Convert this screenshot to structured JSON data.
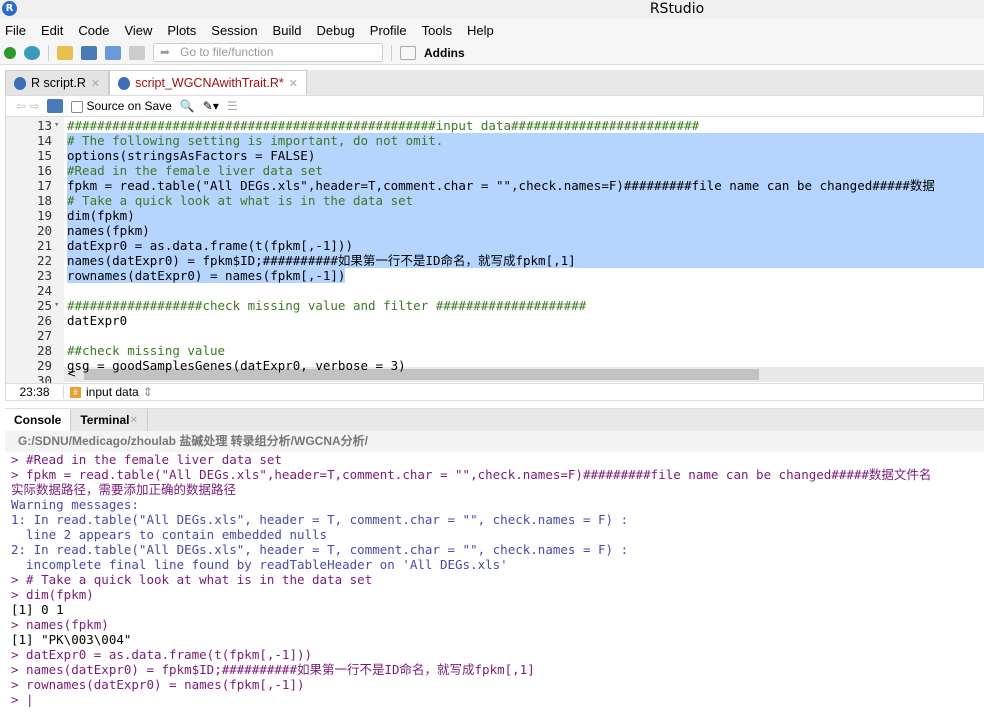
{
  "window": {
    "title": "RStudio",
    "logo": "R"
  },
  "menu": [
    "File",
    "Edit",
    "Code",
    "View",
    "Plots",
    "Session",
    "Build",
    "Debug",
    "Profile",
    "Tools",
    "Help"
  ],
  "toolbar": {
    "goto_placeholder": "Go to file/function",
    "addins": "Addins"
  },
  "tabs": [
    {
      "label": "R script.R",
      "active": false
    },
    {
      "label": "script_WGCNAwithTrait.R*",
      "active": true
    }
  ],
  "editor_toolbar": {
    "source_on_save": "Source on Save"
  },
  "editor": {
    "lines": [
      {
        "n": "13",
        "fold": true,
        "sel": false,
        "text": "#################################################input data#########################",
        "cls": "cm"
      },
      {
        "n": "14",
        "sel": true,
        "text": "# The following setting is important, do not omit.",
        "cls": "cm"
      },
      {
        "n": "15",
        "sel": true,
        "text": "options(stringsAsFactors = FALSE)",
        "cls": ""
      },
      {
        "n": "16",
        "sel": true,
        "text": "#Read in the female liver data set",
        "cls": "cm"
      },
      {
        "n": "17",
        "sel": true,
        "text": "fpkm = read.table(\"All DEGs.xls\",header=T,comment.char = \"\",check.names=F)#########file name can be changed#####数据",
        "cls": ""
      },
      {
        "n": "18",
        "sel": true,
        "text": "# Take a quick look at what is in the data set",
        "cls": "cm"
      },
      {
        "n": "19",
        "sel": true,
        "text": "dim(fpkm)",
        "cls": ""
      },
      {
        "n": "20",
        "sel": true,
        "text": "names(fpkm)",
        "cls": ""
      },
      {
        "n": "21",
        "sel": true,
        "text": "datExpr0 = as.data.frame(t(fpkm[,-1]))",
        "cls": ""
      },
      {
        "n": "22",
        "sel": true,
        "text": "names(datExpr0) = fpkm$ID;##########如果第一行不是ID命名，就写成fpkm[,1]",
        "cls": ""
      },
      {
        "n": "23",
        "sel": "partial",
        "text": "rownames(datExpr0) = names(fpkm[,-1])",
        "cls": ""
      },
      {
        "n": "24",
        "sel": false,
        "text": "",
        "cls": ""
      },
      {
        "n": "25",
        "fold": true,
        "sel": false,
        "text": "##################check missing value and filter ####################",
        "cls": "cm"
      },
      {
        "n": "26",
        "sel": false,
        "text": "datExpr0",
        "cls": ""
      },
      {
        "n": "27",
        "sel": false,
        "text": "",
        "cls": ""
      },
      {
        "n": "28",
        "sel": false,
        "text": "##check missing value",
        "cls": "cm"
      },
      {
        "n": "29",
        "sel": false,
        "text": "gsg = goodSamplesGenes(datExpr0, verbose = 3)",
        "cls": ""
      },
      {
        "n": "30",
        "sel": false,
        "text": "",
        "cls": ""
      }
    ]
  },
  "status": {
    "position": "23:38",
    "section": "input data"
  },
  "console_tabs": [
    {
      "label": "Console",
      "active": true
    },
    {
      "label": "Terminal",
      "active": false
    }
  ],
  "console_path": "G:/SDNU/Medicago/zhoulab 盐碱处理 转录组分析/WGCNA分析/",
  "console": [
    {
      "t": "> #Read in the female liver data set",
      "c": "in"
    },
    {
      "t": "> fpkm = read.table(\"All DEGs.xls\",header=T,comment.char = \"\",check.names=F)#########file name can be changed#####数据文件名",
      "c": "in"
    },
    {
      "t": "实际数据路径，需要添加正确的数据路径",
      "c": "in"
    },
    {
      "t": "Warning messages:",
      "c": "warn"
    },
    {
      "t": "1: In read.table(\"All DEGs.xls\", header = T, comment.char = \"\", check.names = F) :",
      "c": "warn"
    },
    {
      "t": "  line 2 appears to contain embedded nulls",
      "c": "warn"
    },
    {
      "t": "2: In read.table(\"All DEGs.xls\", header = T, comment.char = \"\", check.names = F) :",
      "c": "warn"
    },
    {
      "t": "  incomplete final line found by readTableHeader on 'All DEGs.xls'",
      "c": "warn"
    },
    {
      "t": "> # Take a quick look at what is in the data set",
      "c": "in"
    },
    {
      "t": "> dim(fpkm)",
      "c": "in"
    },
    {
      "t": "[1] 0 1",
      "c": "out"
    },
    {
      "t": "> names(fpkm)",
      "c": "in"
    },
    {
      "t": "[1] \"PK\\003\\004\"",
      "c": "out"
    },
    {
      "t": "> datExpr0 = as.data.frame(t(fpkm[,-1]))",
      "c": "in"
    },
    {
      "t": "> names(datExpr0) = fpkm$ID;##########如果第一行不是ID命名，就写成fpkm[,1]",
      "c": "in"
    },
    {
      "t": "> rownames(datExpr0) = names(fpkm[,-1])",
      "c": "in"
    },
    {
      "t": "> |",
      "c": "in"
    }
  ]
}
